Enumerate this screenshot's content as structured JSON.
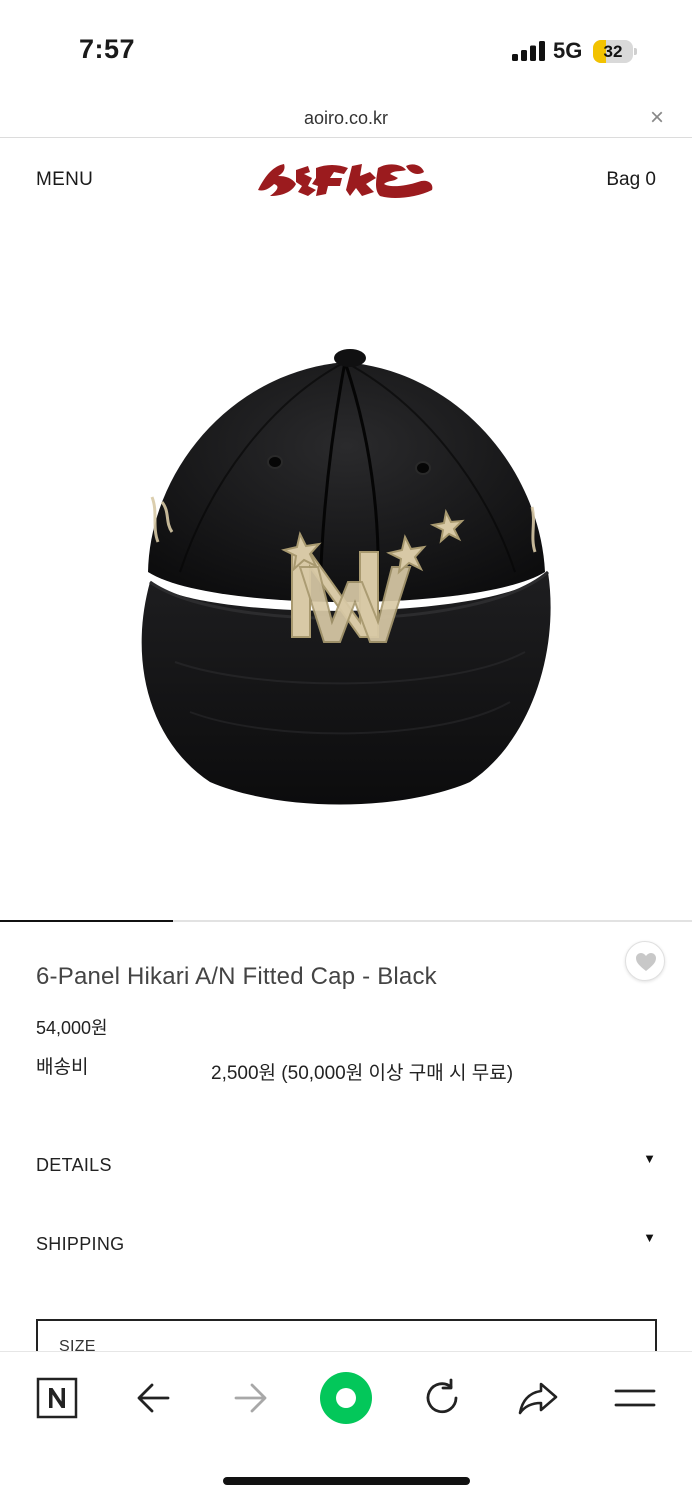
{
  "status_bar": {
    "time": "7:57",
    "network": "5G",
    "battery": "32",
    "battery_level": 0.32
  },
  "browser": {
    "url": "aoiro.co.kr",
    "close_symbol": "×"
  },
  "header": {
    "menu_label": "MENU",
    "logo_alt": "aoiro",
    "bag_label": "Bag 0"
  },
  "gallery": {
    "progress": 0.25
  },
  "product": {
    "title": "6-Panel Hikari A/N Fitted Cap - Black",
    "price": "54,000원",
    "shipping_label": "배송비",
    "shipping_value": "2,500원 (50,000원 이상 구매 시 무료)"
  },
  "accordions": [
    {
      "label": "DETAILS",
      "caret": "▼"
    },
    {
      "label": "SHIPPING",
      "caret": "▼"
    }
  ],
  "size_select": {
    "label": "SIZE"
  },
  "toolbar": {
    "items": [
      "naver-home",
      "back",
      "forward",
      "green-dot",
      "reload",
      "share",
      "menu"
    ]
  },
  "colors": {
    "logo_red": "#9b1b1e",
    "green": "#03c75a",
    "cap": "#151516",
    "embroidery": "#d8c9a6"
  }
}
